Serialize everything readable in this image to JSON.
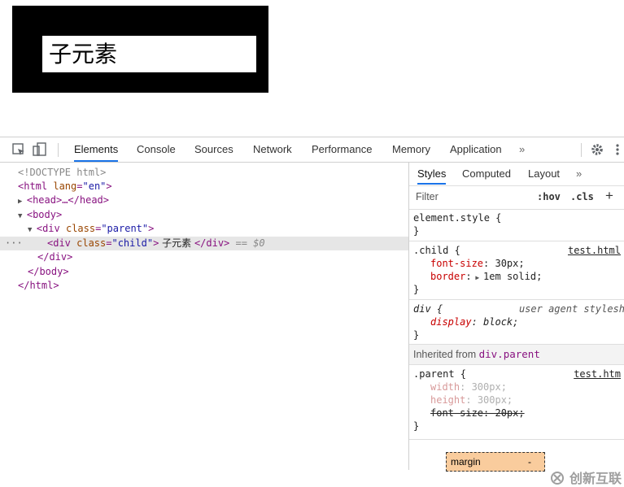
{
  "preview": {
    "child_text": "子元素"
  },
  "devtools": {
    "tabs": [
      "Elements",
      "Console",
      "Sources",
      "Network",
      "Performance",
      "Memory",
      "Application"
    ],
    "more": "»",
    "dom": {
      "doctype": "<!DOCTYPE html>",
      "html_open": "<html ",
      "html_attr": "lang",
      "html_val": "\"en\"",
      "head": "<head>…</head>",
      "body_open": "<body>",
      "div_parent_open": "<div ",
      "attr_class": "class",
      "val_parent": "\"parent\"",
      "val_child": "\"child\"",
      "child_text": " 子元素 ",
      "div_close": "</div>",
      "selected_marker": " == $0",
      "body_close": "</body>",
      "html_close": "</html>",
      "ellipsis": "···"
    },
    "styles": {
      "tabs": [
        "Styles",
        "Computed",
        "Layout",
        "»"
      ],
      "filter_placeholder": "Filter",
      "hov": ":hov",
      "cls": ".cls",
      "plus": "+",
      "element_style": "element.style {",
      "close_brace": "}",
      "child_selector": ".child {",
      "child_source": "test.html",
      "child_props": [
        {
          "name": "font-size",
          "value": "30px;"
        },
        {
          "name": "border",
          "value": "1em solid;"
        }
      ],
      "div_selector": "div {",
      "div_source": "user agent stylesh",
      "div_prop": {
        "name": "display",
        "value": "block;"
      },
      "inherited_label": "Inherited from ",
      "inherited_from": "div.parent",
      "parent_selector": ".parent {",
      "parent_source": "test.htm",
      "parent_props": [
        {
          "name": "width",
          "value": "300px;"
        },
        {
          "name": "height",
          "value": "300px;"
        },
        {
          "name": "font-size",
          "value": "20px;"
        }
      ],
      "box_margin_label": "margin",
      "box_margin_value": "-"
    },
    "watermark": "创新互联"
  },
  "colors": {
    "accent": "#1a73e8",
    "tag": "#881280",
    "attr_name": "#994500",
    "attr_value": "#1a1aa6",
    "prop": "#c80000",
    "margin_box": "#f9cc9d"
  }
}
